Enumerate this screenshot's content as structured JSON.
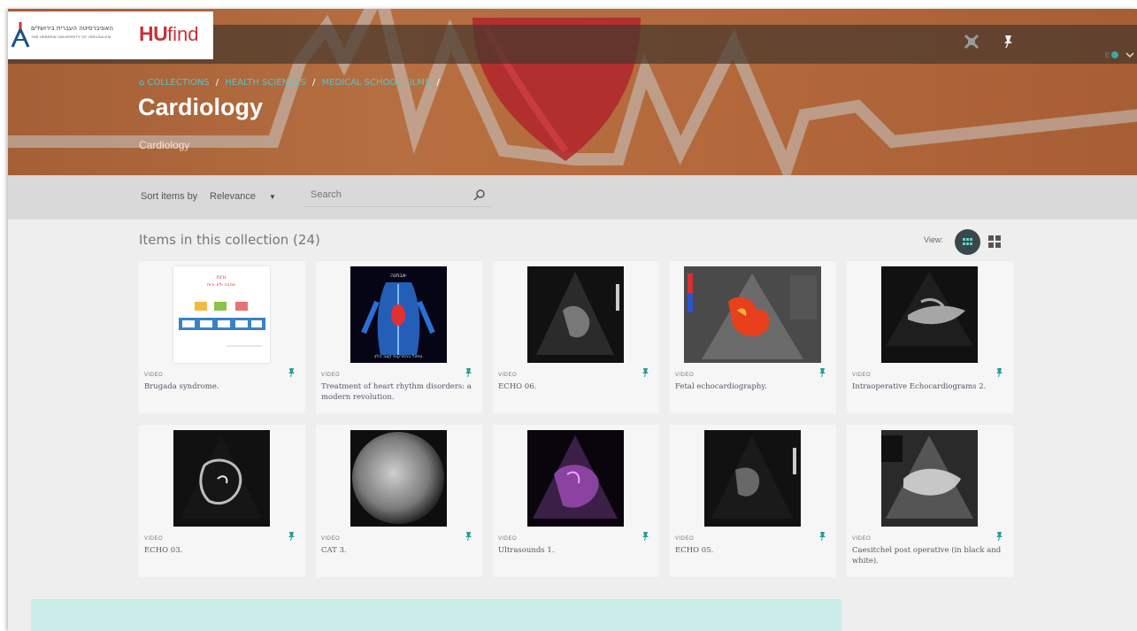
{
  "logo": {
    "hebrew_text": "האוניברסיטה העברית בירושלים",
    "english_text": "THE HEBREW UNIVERSITY OF JERUSALEM",
    "brand_hu": "HU",
    "brand_find": "find"
  },
  "nav": {
    "items": [
      "",
      "",
      "",
      "",
      "",
      "",
      ""
    ],
    "sign_in": "",
    "language": "",
    "icons": [
      "collection-icon",
      "pin-icon",
      "language-icon"
    ]
  },
  "breadcrumb": {
    "items": [
      "COLLECTIONS",
      "HEALTH SCIENCES",
      "MEDICAL SCHOOL FILMS"
    ]
  },
  "page": {
    "title": "Cardiology",
    "subtitle": "Cardiology"
  },
  "toolbar": {
    "sort_label": "Sort items by",
    "sort_value": "Relevance",
    "search_placeholder": "Search"
  },
  "collection": {
    "heading": "Items in this collection (24)",
    "view_label": "View:",
    "items": [
      {
        "type": "VIDEO",
        "title": "Brugada syndrome."
      },
      {
        "type": "VIDEO",
        "title": "Treatment of heart rhythm disorders: a modern revolution."
      },
      {
        "type": "VIDEO",
        "title": "ECHO 06."
      },
      {
        "type": "VIDEO",
        "title": "Fetal echocardiography."
      },
      {
        "type": "VIDEO",
        "title": "Intraoperative Echocardiograms 2."
      },
      {
        "type": "VIDEO",
        "title": "ECHO 03."
      },
      {
        "type": "VIDEO",
        "title": "CAT 3."
      },
      {
        "type": "VIDEO",
        "title": "Ultrasounds 1."
      },
      {
        "type": "VIDEO",
        "title": "ECHO 05."
      },
      {
        "type": "VIDEO",
        "title": "Caesitchel post operative (in black and white)."
      }
    ]
  },
  "colors": {
    "hero": "#b06a3c",
    "accent_teal": "#3aa7a1",
    "toolbar": "#d9d9d9",
    "panel": "#c9ece9"
  }
}
